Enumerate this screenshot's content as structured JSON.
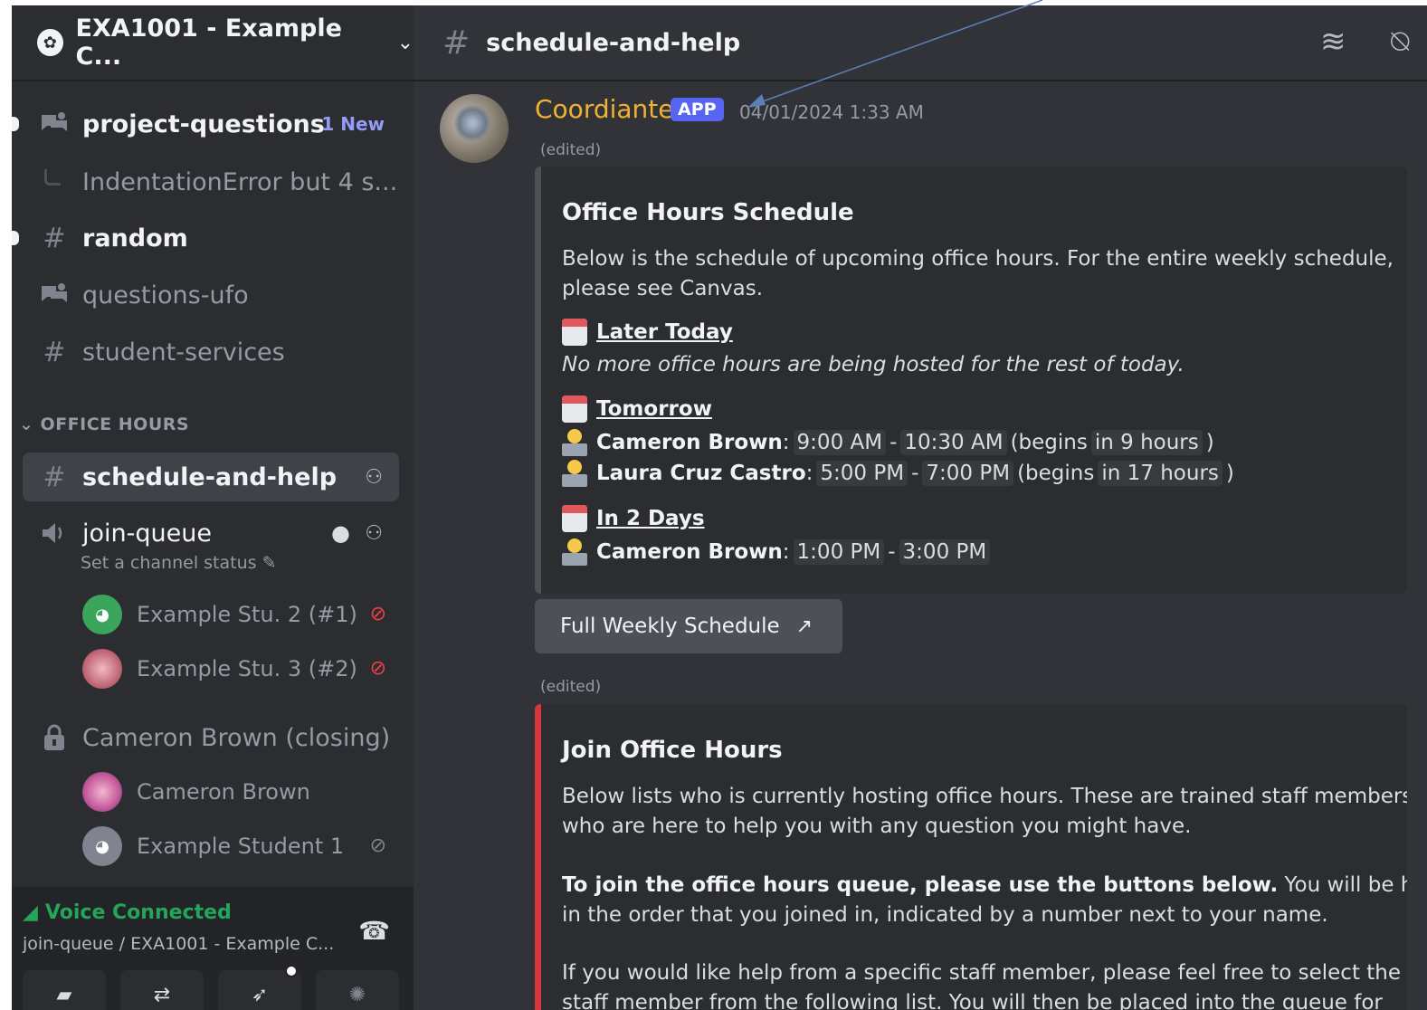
{
  "server": {
    "name": "EXA1001 - Example C..."
  },
  "sidebar": {
    "channels": [
      {
        "name": "project-questions",
        "badge": "1 New"
      },
      {
        "thread": "IndentationError but 4 s..."
      },
      {
        "name": "random"
      },
      {
        "name": "questions-ufo"
      },
      {
        "name": "student-services"
      }
    ],
    "category": "OFFICE HOURS",
    "office_channels": [
      {
        "name": "schedule-and-help"
      },
      {
        "name": "join-queue",
        "status": "Set a channel status"
      }
    ],
    "queue_users": [
      {
        "name": "Example Stu. 2 (#1)"
      },
      {
        "name": "Example Stu. 3 (#2)"
      }
    ],
    "private_channel": "Cameron Brown (closing)",
    "room_users": [
      {
        "name": "Cameron Brown"
      },
      {
        "name": "Example Student 1"
      }
    ]
  },
  "voice": {
    "label": "Voice Connected",
    "sub": "join-queue / EXA1001 - Example C..."
  },
  "header": {
    "channel": "schedule-and-help"
  },
  "message": {
    "author": "Coordiante",
    "badge": "APP",
    "timestamp": "04/01/2024 1:33 AM",
    "edited": "(edited)"
  },
  "embed1": {
    "title": "Office Hours Schedule",
    "desc_line1": "Below is the schedule of upcoming office hours. For the entire weekly schedule,",
    "desc_line2": "please see Canvas.",
    "later_today": "Later Today",
    "no_more": "No more office hours are being hosted for the rest of today.",
    "tomorrow": "Tomorrow",
    "tomorrow_rows": [
      {
        "name": "Cameron Brown",
        "start": "9:00 AM",
        "end": "10:30 AM",
        "begins_prefix": "(begins",
        "begins": "in 9 hours",
        "begins_suffix": ")"
      },
      {
        "name": "Laura Cruz Castro",
        "start": "5:00 PM",
        "end": "7:00 PM",
        "begins_prefix": "(begins",
        "begins": "in 17 hours",
        "begins_suffix": ")"
      }
    ],
    "in_2_days": "In 2 Days",
    "in_2_days_rows": [
      {
        "name": "Cameron Brown",
        "start": "1:00 PM",
        "end": "3:00 PM"
      }
    ],
    "color": "#4e5058"
  },
  "button": {
    "label": "Full Weekly Schedule"
  },
  "embed2": {
    "title": "Join Office Hours",
    "line1": "Below lists who is currently hosting office hours. These are trained staff members",
    "line2": "who are here to help you with any question you might have.",
    "line3_bold": "To join the office hours queue, please use the buttons below.",
    "line3_rest": " You will be helped",
    "line4": "in the order that you joined in, indicated by a number next to your name.",
    "line5": "If you would like help from a specific staff member, please feel free to select the",
    "line6": "staff member from the following list. You will then be placed into the queue for",
    "color": "#da373c"
  },
  "colors": {
    "accent": "#5865f2",
    "voice_green": "#23a55a",
    "mute_red": "#f23f43",
    "author": "#f0b232"
  },
  "icons": {
    "server": "server-icon",
    "forum": "forum-channel-icon",
    "text": "text-channel-icon",
    "voice": "voice-channel-icon",
    "lock": "lock-icon",
    "threads": "threads-icon",
    "notifications_off": "bell-off-icon"
  }
}
